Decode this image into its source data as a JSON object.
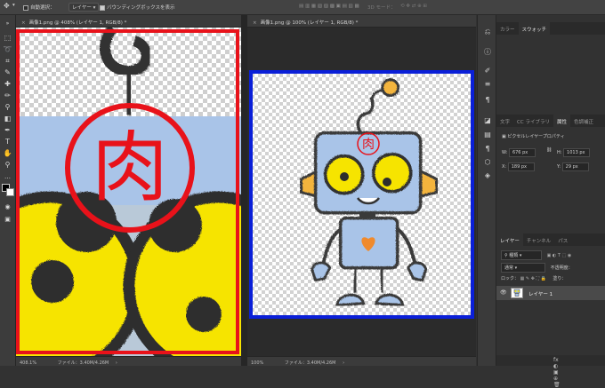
{
  "optbar": {
    "auto_select_label": "自動選択：",
    "layer_select": "レイヤー",
    "bounding_box_label": "バウンディングボックスを表示",
    "mode3d_label": "3D モード："
  },
  "tabs": {
    "doc1": "画像1.png @ 408% (レイヤー 1, RGB/8) *",
    "doc2": "画像1.png @ 100% (レイヤー 1, RGB/8) *"
  },
  "doc1": {
    "zoom": "408.1%",
    "file_info": "ファイル：3.40M/4.26M",
    "kanji": "肉"
  },
  "doc2": {
    "zoom": "100%",
    "file_info": "ファイル：3.40M/4.26M",
    "kanji": "肉"
  },
  "colors": {
    "red_highlight": "#e8121a",
    "blue_highlight": "#0a1fd8",
    "robot_body": "#a9c4e8",
    "robot_eye": "#f6e400",
    "robot_ear": "#f3b43c",
    "robot_heart": "#f08a2c"
  },
  "panel_top": {
    "tabs": [
      "カラー",
      "スウォッチ"
    ],
    "active": "スウォッチ"
  },
  "panel_mid": {
    "tabs": [
      "文字",
      "CC ライブラリ",
      "属性",
      "色調補正"
    ],
    "active": "属性",
    "section_label": "ピクセルレイヤープロパティ",
    "w_label": "W:",
    "w_value": "676 px",
    "h_label": "H:",
    "h_value": "1013 px",
    "x_label": "X:",
    "x_value": "189 px",
    "y_label": "Y:",
    "y_value": "29 px"
  },
  "layers_panel": {
    "tabs": [
      "レイヤー",
      "チャンネル",
      "パス"
    ],
    "active": "レイヤー",
    "filter_label": "種類",
    "blend_mode": "通常",
    "opacity_label": "不透明度：",
    "lock_label": "ロック：",
    "fill_label": "塗り：",
    "layer_name": "レイヤー 1"
  }
}
